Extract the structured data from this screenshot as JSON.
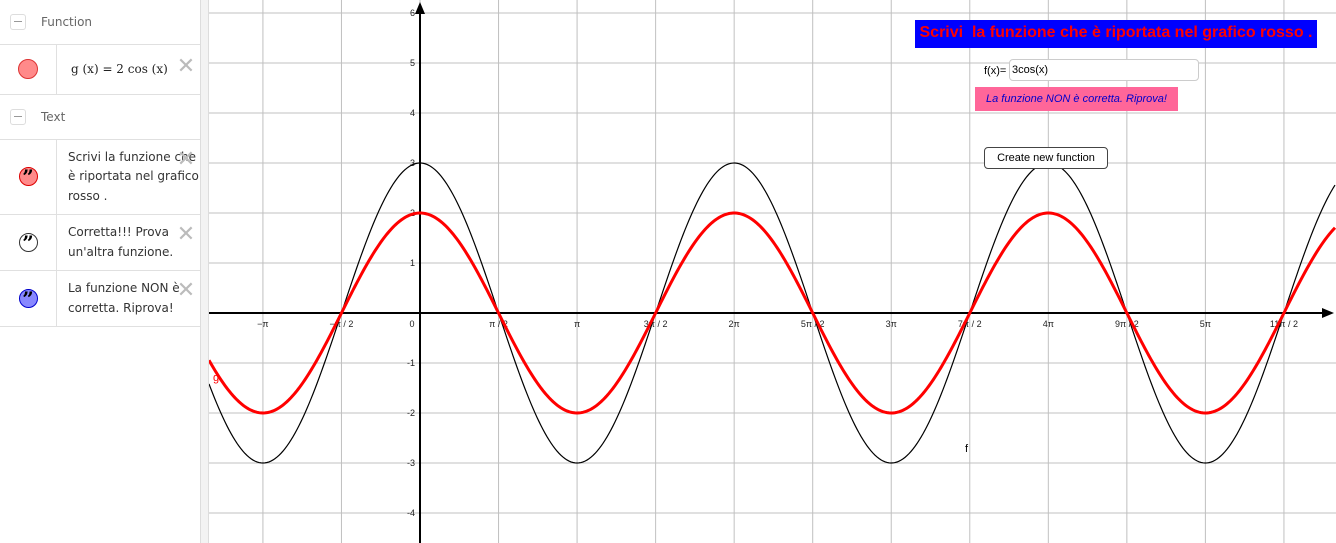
{
  "algebra": {
    "groups": [
      {
        "label": "Function",
        "items": [
          {
            "name": "g",
            "text": "g (x)  =  2  cos (x)",
            "color": "#ff8a8a",
            "kind": "function"
          }
        ]
      },
      {
        "label": "Text",
        "items": [
          {
            "name": "text1",
            "text": "Scrivi la funzione che è riportata nel grafico rosso .",
            "color": "#ff8a8a",
            "border": "#d00",
            "kind": "text"
          },
          {
            "name": "text2",
            "text": "Corretta!!! Prova un'altra funzione.",
            "color": "#ffffff",
            "border": "#333",
            "kind": "text"
          },
          {
            "name": "text3",
            "text": "La funzione NON è corretta. Riprova!",
            "color": "#8888ff",
            "border": "#00c",
            "kind": "text"
          }
        ]
      }
    ]
  },
  "graphics": {
    "title": "Scrivi  la funzione che è riportata nel grafico rosso .",
    "input_label": "f(x)=",
    "input_value": "3cos(x)",
    "message": "La funzione NON è corretta. Riprova!",
    "create_button": "Create new function",
    "label_f": "f",
    "label_g": "g"
  },
  "chart_data": {
    "type": "line",
    "title": "",
    "xlabel": "",
    "ylabel": "",
    "xlim": [
      -4.2,
      18.3
    ],
    "ylim": [
      -4.6,
      6.2
    ],
    "grid": true,
    "x_ticks": [
      {
        "value": -3.14159,
        "label": "−π"
      },
      {
        "value": -1.5708,
        "label": "−π / 2"
      },
      {
        "value": 0,
        "label": "0"
      },
      {
        "value": 1.5708,
        "label": "π / 2"
      },
      {
        "value": 3.14159,
        "label": "π"
      },
      {
        "value": 4.71239,
        "label": "3π / 2"
      },
      {
        "value": 6.28319,
        "label": "2π"
      },
      {
        "value": 7.85398,
        "label": "5π / 2"
      },
      {
        "value": 9.42478,
        "label": "3π"
      },
      {
        "value": 10.9956,
        "label": "7π / 2"
      },
      {
        "value": 12.5664,
        "label": "4π"
      },
      {
        "value": 14.1372,
        "label": "9π / 2"
      },
      {
        "value": 15.708,
        "label": "5π"
      },
      {
        "value": 17.2788,
        "label": "11π / 2"
      }
    ],
    "y_ticks": [
      -4,
      -3,
      -2,
      -1,
      1,
      2,
      3,
      4,
      5,
      6
    ],
    "series": [
      {
        "name": "g",
        "expression": "2cos(x)",
        "amplitude": 2,
        "color": "#ff0000"
      },
      {
        "name": "f",
        "expression": "3cos(x)",
        "amplitude": 3,
        "color": "#000000"
      }
    ]
  }
}
